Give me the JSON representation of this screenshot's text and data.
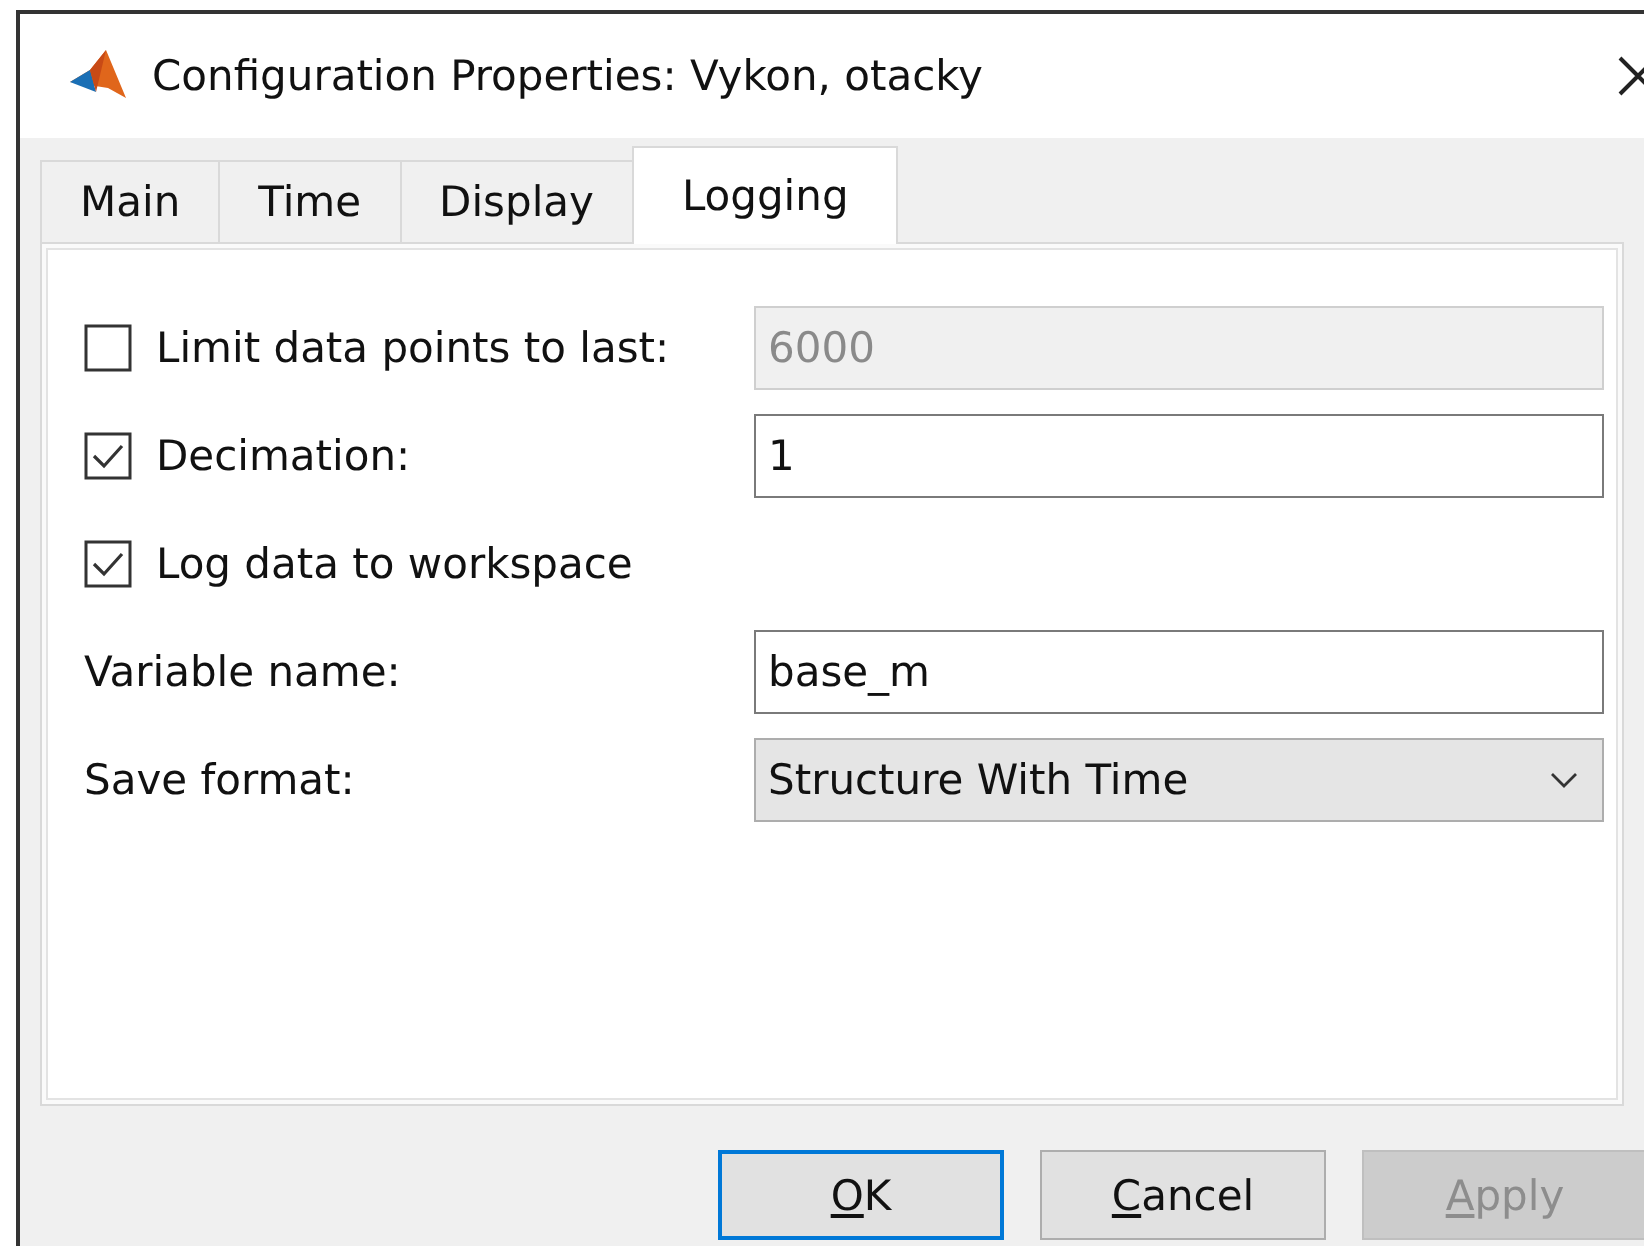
{
  "window": {
    "title": "Configuration Properties: Vykon, otacky"
  },
  "tabs": [
    {
      "label": "Main",
      "selected": false
    },
    {
      "label": "Time",
      "selected": false
    },
    {
      "label": "Display",
      "selected": false
    },
    {
      "label": "Logging",
      "selected": true
    }
  ],
  "rows": [
    {
      "kind": "checkbox-field",
      "label": "Limit data points to last:",
      "checked": false,
      "value": "6000",
      "disabled": true
    },
    {
      "kind": "checkbox-field",
      "label": "Decimation:",
      "checked": true,
      "value": "1",
      "disabled": false
    },
    {
      "kind": "checkbox",
      "label": "Log data to workspace",
      "checked": true
    },
    {
      "kind": "field",
      "label": "Variable name:",
      "value": "base_m"
    },
    {
      "kind": "dropdown",
      "label": "Save format:",
      "value": "Structure With Time"
    }
  ],
  "buttons": [
    {
      "label": "OK",
      "default": true,
      "disabled": false
    },
    {
      "label": "Cancel",
      "default": false,
      "disabled": false
    },
    {
      "label": "Apply",
      "default": false,
      "disabled": true
    }
  ]
}
